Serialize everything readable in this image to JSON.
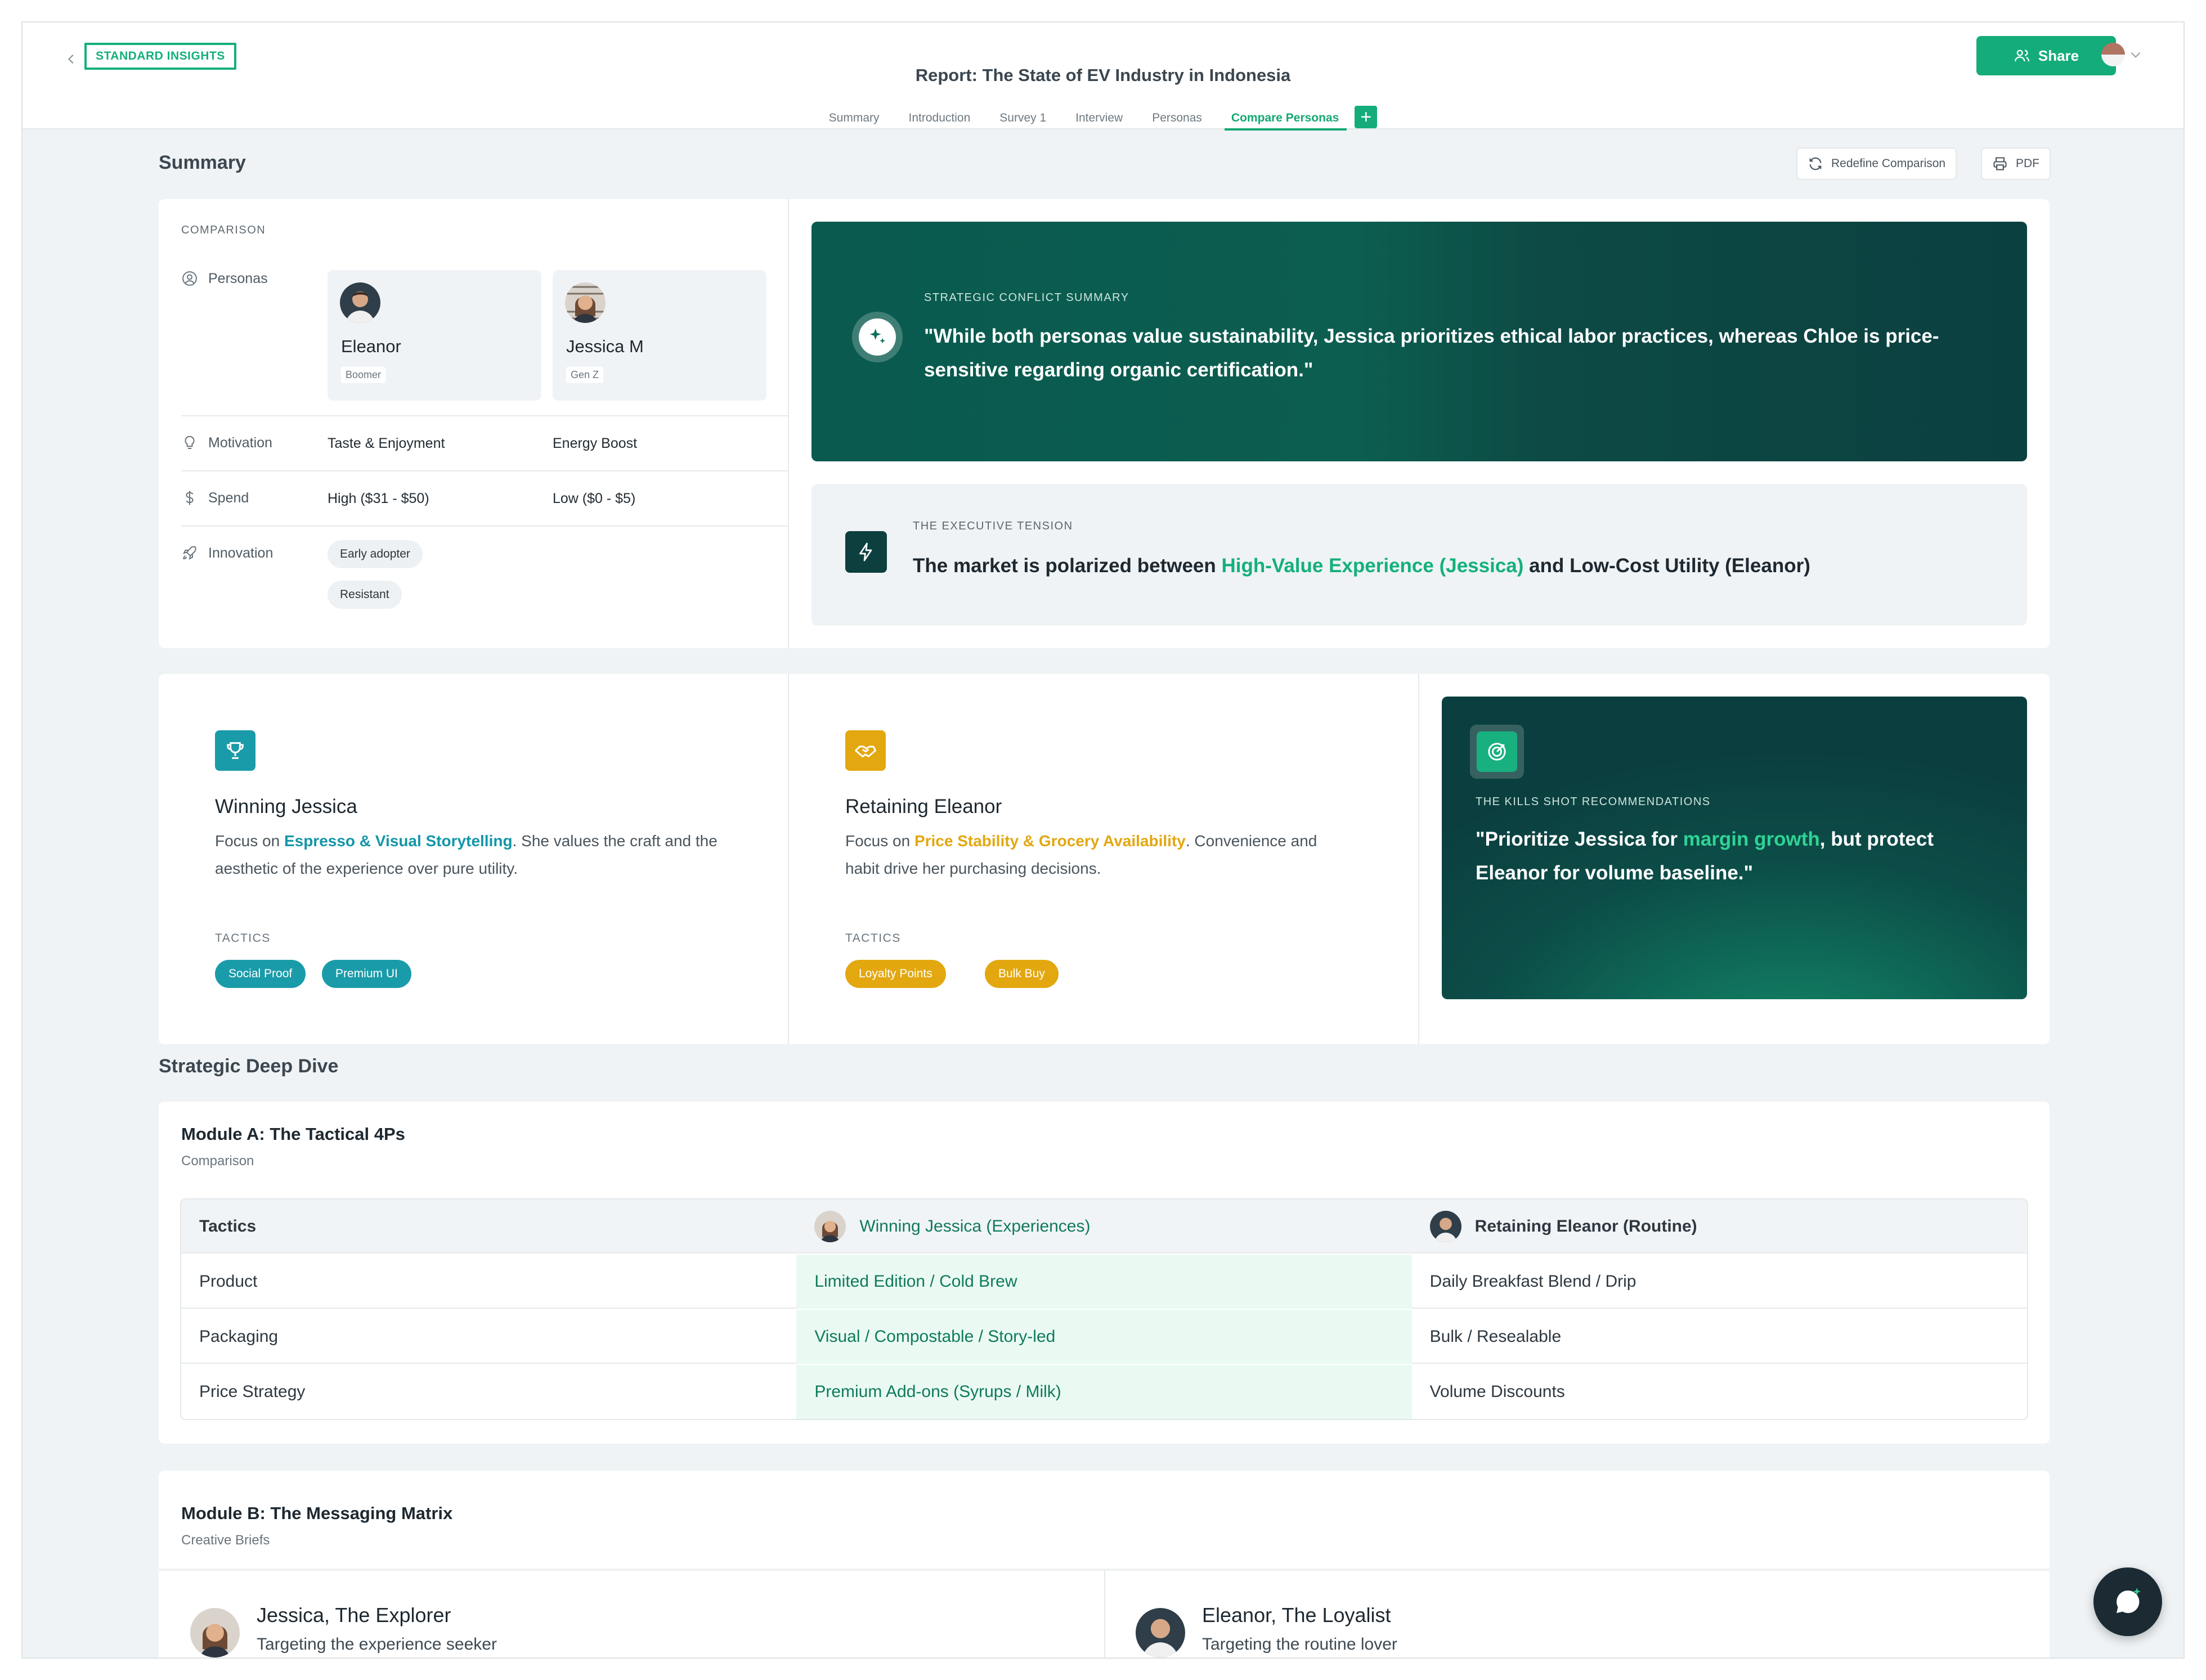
{
  "header": {
    "badge": "STANDARD INSIGHTS",
    "title": "Report: The State of EV Industry in Indonesia",
    "share_label": "Share",
    "tabs": [
      {
        "label": "Summary"
      },
      {
        "label": "Introduction"
      },
      {
        "label": "Survey 1"
      },
      {
        "label": "Interview"
      },
      {
        "label": "Personas"
      },
      {
        "label": "Compare Personas",
        "active": true
      }
    ],
    "add_tab": "+"
  },
  "summary": {
    "title": "Summary",
    "redefine_label": "Redefine Comparison",
    "pdf_label": "PDF"
  },
  "comparison": {
    "label": "COMPARISON",
    "personas_label": "Personas",
    "motivation_label": "Motivation",
    "spend_label": "Spend",
    "innovation_label": "Innovation",
    "personas": [
      {
        "name": "Eleanor",
        "generation": "Boomer",
        "motivation": "Taste & Enjoyment",
        "spend": "High ($31 - $50)",
        "innovation": "Early adopter"
      },
      {
        "name": "Jessica M",
        "generation": "Gen Z",
        "motivation": "Energy Boost",
        "spend": "Low ($0 - $5)",
        "innovation": "Resistant"
      }
    ]
  },
  "conflict": {
    "eyebrow": "STRATEGIC CONFLICT SUMMARY",
    "quote": "\"While both personas value sustainability, Jessica prioritizes ethical labor practices, whereas Chloe is price-sensitive regarding organic certification.\""
  },
  "tension": {
    "eyebrow": "THE EXECUTIVE TENSION",
    "prefix": "The market is polarized between ",
    "highlight": "High-Value Experience (Jessica)",
    "suffix": " and Low-Cost Utility (Eleanor)"
  },
  "winning": {
    "title": "Winning Jessica",
    "body_prefix": "Focus on ",
    "body_highlight": "Espresso & Visual Storytelling",
    "body_suffix": ". She values the craft and the aesthetic of the experience over pure utility.",
    "tactics_label": "TACTICS",
    "tactics": [
      "Social Proof",
      "Premium UI"
    ]
  },
  "retaining": {
    "title": "Retaining Eleanor",
    "body_prefix": "Focus on ",
    "body_highlight": "Price Stability & Grocery Availability",
    "body_suffix": ". Convenience and habit drive her purchasing decisions.",
    "tactics_label": "TACTICS",
    "tactics": [
      "Loyalty Points",
      "Bulk Buy"
    ]
  },
  "killshot": {
    "eyebrow": "THE KILLS SHOT RECOMMENDATIONS",
    "quote_prefix": "\"Prioritize Jessica for ",
    "quote_highlight": "margin growth",
    "quote_suffix": ", but protect Eleanor for volume baseline.\""
  },
  "deep_dive": {
    "title": "Strategic Deep Dive",
    "module_a": {
      "title": "Module A: The Tactical 4Ps",
      "subtitle": "Comparison",
      "headers": [
        "Tactics",
        "Winning Jessica (Experiences)",
        "Retaining Eleanor (Routine)"
      ],
      "rows": [
        [
          "Product",
          "Limited Edition / Cold Brew",
          "Daily Breakfast Blend / Drip"
        ],
        [
          "Packaging",
          "Visual / Compostable / Story-led",
          "Bulk / Resealable"
        ],
        [
          "Price Strategy",
          "Premium Add-ons (Syrups / Milk)",
          "Volume Discounts"
        ]
      ]
    },
    "module_b": {
      "title": "Module B: The Messaging Matrix",
      "subtitle": "Creative Briefs",
      "briefs": [
        {
          "name": "Jessica, The Explorer",
          "subtitle": "Targeting the experience seeker"
        },
        {
          "name": "Eleanor, The Loyalist",
          "subtitle": "Targeting the routine lover"
        }
      ]
    }
  },
  "colors": {
    "accent": "#14ac7a",
    "teal": "#1396a8",
    "amber": "#e3a710",
    "dark_panel": "#0b4040"
  },
  "icons": {
    "back": "chevron-left-icon",
    "share": "users-icon",
    "redefine": "refresh-icon",
    "pdf": "printer-icon",
    "personas": "user-circle-icon",
    "motivation": "lightbulb-icon",
    "spend": "dollar-icon",
    "innovation": "rocket-icon",
    "conflict": "sparkle-icon",
    "tension": "bolt-icon",
    "winning": "trophy-icon",
    "retaining": "handshake-icon",
    "killshot": "target-icon",
    "chat": "chat-sparkle-icon"
  }
}
